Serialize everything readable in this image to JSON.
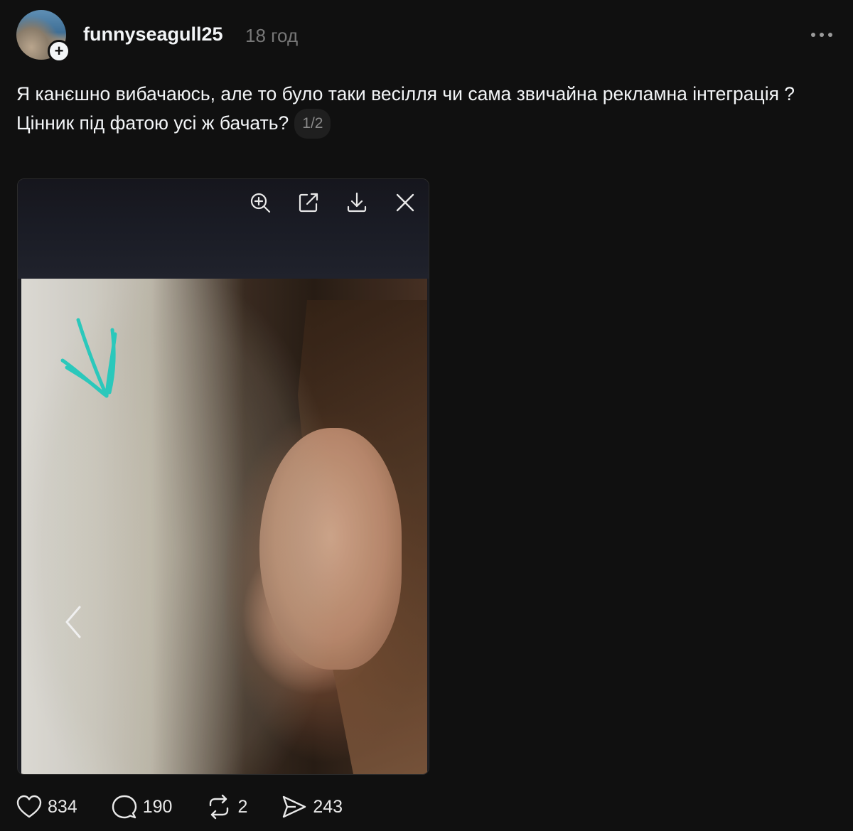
{
  "post": {
    "username": "funnyseagull25",
    "time": "18 год",
    "text_line1": "Я канєшно вибачаюсь, але то було таки весілля чи сама звичайна рекламна інтеграція ?",
    "text_line2": "Цінник під фатою усі ж бачать?",
    "media_counter": "1/2"
  },
  "actions": {
    "likes": "834",
    "comments": "190",
    "reposts": "2",
    "shares": "243"
  },
  "icons": {
    "avatar_badge": "plus-icon",
    "more": "more-dots-icon",
    "toolbar": [
      "zoom-in-icon",
      "open-external-icon",
      "download-icon",
      "close-icon"
    ],
    "nav": "chevron-left-icon",
    "actions": [
      "heart-icon",
      "comment-icon",
      "repost-icon",
      "share-icon"
    ]
  },
  "colors": {
    "background": "#101010",
    "text": "#f3f5f7",
    "muted": "#777777",
    "annotation_arrow": "#2ed3c6"
  }
}
